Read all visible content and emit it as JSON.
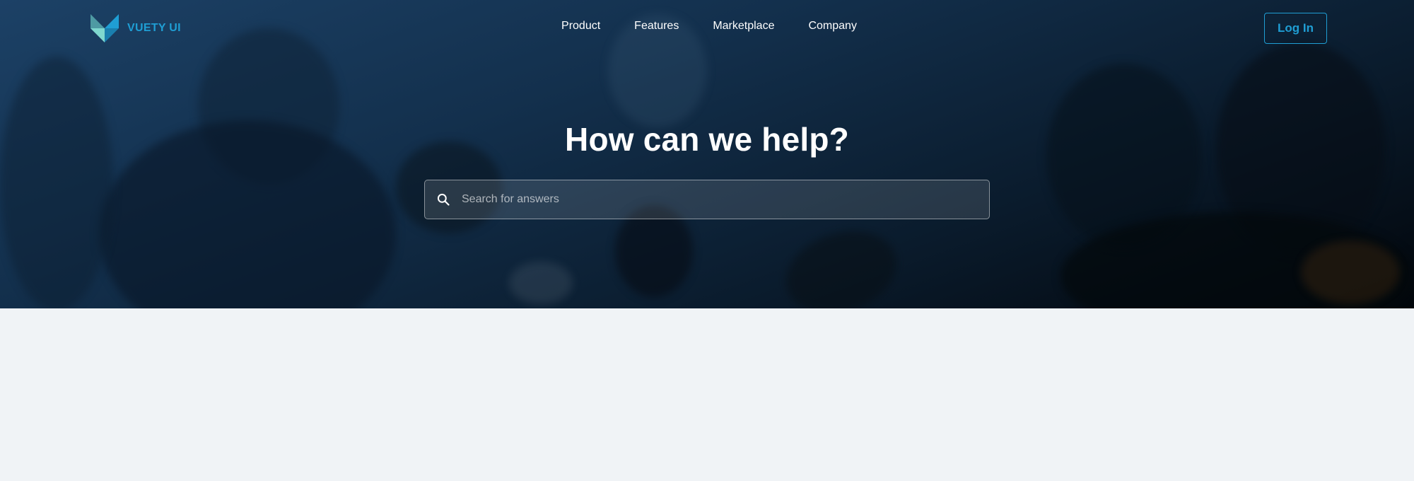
{
  "brand": {
    "name": "VUETY UI",
    "logo_icon": "vuety-logo-icon"
  },
  "nav": {
    "items": [
      {
        "label": "Product"
      },
      {
        "label": "Features"
      },
      {
        "label": "Marketplace"
      },
      {
        "label": "Company"
      }
    ],
    "login_label": "Log In"
  },
  "hero": {
    "headline": "How can we help?",
    "search": {
      "placeholder": "Search for answers",
      "value": "",
      "icon": "search-icon"
    }
  },
  "colors": {
    "accent": "#1f9ed4",
    "hero_background": "#15314f",
    "page_background": "#f0f3f6",
    "text_light": "#ffffff"
  }
}
